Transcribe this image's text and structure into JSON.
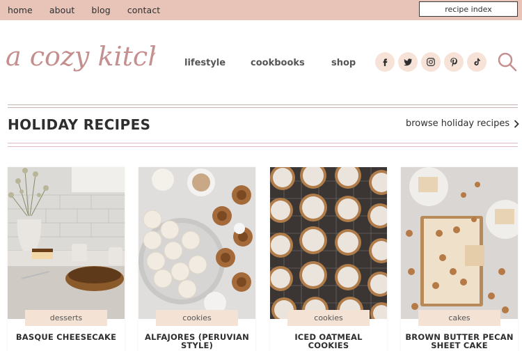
{
  "topbar": {
    "nav": [
      "home",
      "about",
      "blog",
      "contact"
    ],
    "recipe_index": "recipe index"
  },
  "header": {
    "logo_text": "a cozy kitchen",
    "nav": [
      "lifestyle",
      "cookbooks",
      "shop"
    ],
    "social_icons": [
      "facebook-icon",
      "twitter-icon",
      "instagram-icon",
      "pinterest-icon",
      "tiktok-icon"
    ],
    "accent_color": "#c48f8f"
  },
  "section": {
    "title": "HOLIDAY RECIPES",
    "browse_link": "browse holiday recipes"
  },
  "cards": [
    {
      "category": "desserts",
      "title": "BASQUE CHEESECAKE"
    },
    {
      "category": "cookies",
      "title": "ALFAJORES (PERUVIAN STYLE)"
    },
    {
      "category": "cookies",
      "title": "ICED OATMEAL COOKIES"
    },
    {
      "category": "cakes",
      "title": "BROWN BUTTER PECAN SHEET CAKE"
    }
  ],
  "colors": {
    "topbar_bg": "#e8c4b8",
    "badge_bg": "#f4e2d4",
    "social_bg": "#f6e2d6"
  }
}
